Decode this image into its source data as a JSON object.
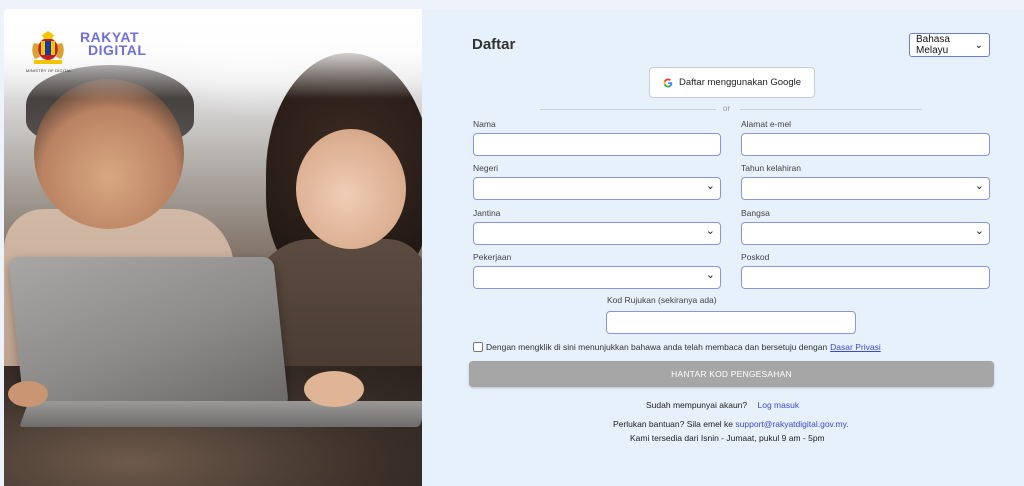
{
  "brand": {
    "line1": "RAKYAT",
    "line2": "DIGITAL",
    "ministry_text": "MINISTRY OF DIGITAL",
    "color": "#6f6fd8"
  },
  "form": {
    "title": "Daftar",
    "language_select": {
      "value": "Bahasa Melayu"
    },
    "google_button": "Daftar menggunakan Google",
    "or_text": "or",
    "fields": {
      "nama": {
        "label": "Nama",
        "value": ""
      },
      "email": {
        "label": "Alamat e-mel",
        "value": ""
      },
      "negeri": {
        "label": "Negeri",
        "value": ""
      },
      "tahun": {
        "label": "Tahun kelahiran",
        "value": ""
      },
      "jantina": {
        "label": "Jantina",
        "value": ""
      },
      "bangsa": {
        "label": "Bangsa",
        "value": ""
      },
      "pekerjaan": {
        "label": "Pekerjaan",
        "value": ""
      },
      "poskod": {
        "label": "Poskod",
        "value": ""
      },
      "kod_rujukan": {
        "label": "Kod Rujukan (sekiranya ada)",
        "value": ""
      }
    },
    "consent": {
      "text": "Dengan mengklik di sini menunjukkan bahawa anda telah membaca dan bersetuju dengan",
      "link": "Dasar Privasi",
      "checked": false
    },
    "submit_button": "HANTAR KOD PENGESAHAN",
    "login_prompt": "Sudah mempunyai akaun?",
    "login_link": "Log masuk",
    "help_text": "Perlukan bantuan? Sila emel ke",
    "help_email": "support@rakyatdigital.gov.my.",
    "hours_text": "Kami tersedia dari Isnin - Jumaat, pukul 9 am - 5pm"
  },
  "colors": {
    "accent": "#3a4ad0",
    "field_border": "#8a94e0",
    "panel_bg": "#e6f1fc",
    "submit_disabled": "#a6a6a6"
  }
}
